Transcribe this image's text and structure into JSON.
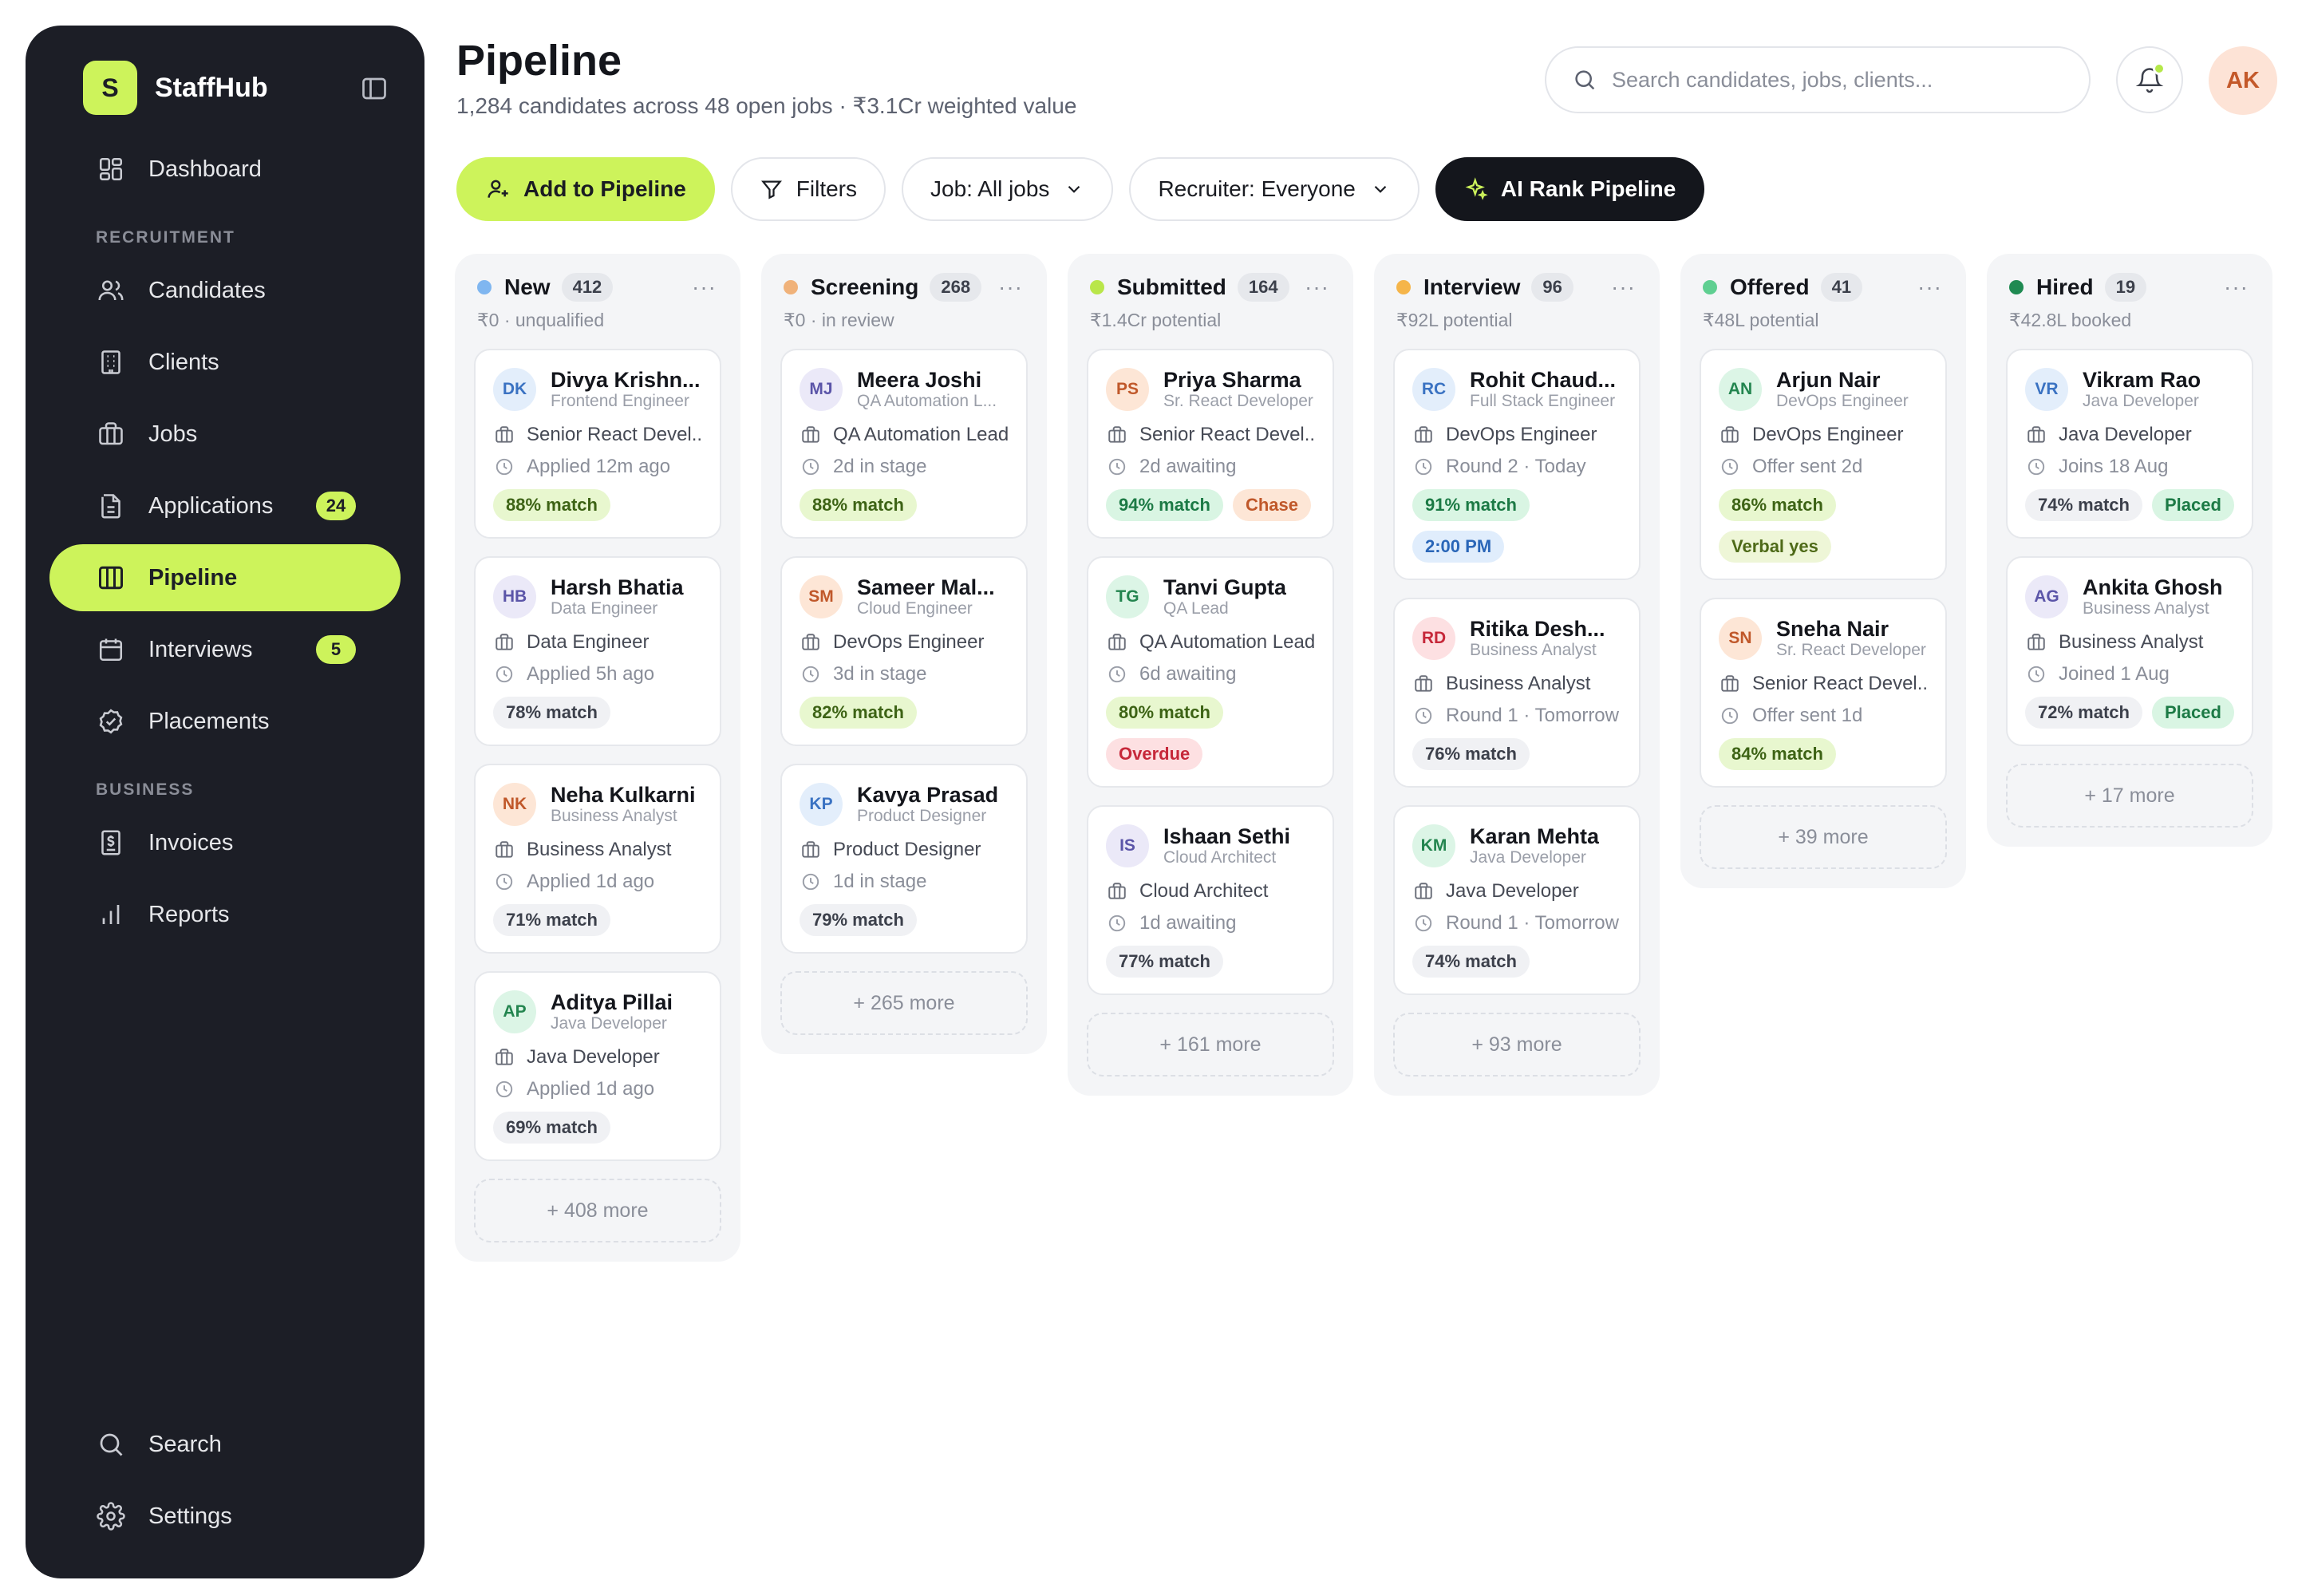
{
  "app": {
    "logo_letter": "S",
    "name": "StaffHub"
  },
  "sidebar": {
    "items": [
      {
        "label": "Dashboard",
        "icon": "dashboard-icon"
      },
      {
        "label": "Candidates",
        "icon": "users-icon"
      },
      {
        "label": "Clients",
        "icon": "building-icon"
      },
      {
        "label": "Jobs",
        "icon": "briefcase-icon"
      },
      {
        "label": "Applications",
        "icon": "document-icon",
        "badge": "24"
      },
      {
        "label": "Pipeline",
        "icon": "columns-icon",
        "active": true
      },
      {
        "label": "Interviews",
        "icon": "calendar-icon",
        "badge": "5"
      },
      {
        "label": "Placements",
        "icon": "check-badge-icon"
      },
      {
        "label": "Invoices",
        "icon": "invoice-icon"
      },
      {
        "label": "Reports",
        "icon": "bar-chart-icon"
      }
    ],
    "sections": {
      "recruitment": "RECRUITMENT",
      "business": "BUSINESS"
    },
    "bottom": [
      {
        "label": "Search",
        "icon": "search-icon"
      },
      {
        "label": "Settings",
        "icon": "gear-icon"
      }
    ]
  },
  "header": {
    "title": "Pipeline",
    "subtitle": "1,284 candidates across 48 open jobs · ₹3.1Cr weighted value",
    "search_placeholder": "Search candidates, jobs, clients...",
    "avatar_initials": "AK"
  },
  "toolbar": {
    "add": "Add to Pipeline",
    "filters": "Filters",
    "job": "Job: All jobs",
    "recruiter": "Recruiter: Everyone",
    "ai_rank": "AI Rank Pipeline"
  },
  "colors": {
    "accent": "#cdf35b",
    "sidebar_bg": "#1c1e26",
    "stage_new": "#7fb6f0",
    "stage_screening": "#f0b27a",
    "stage_submitted": "#b9e64a",
    "stage_interview": "#f5b54a",
    "stage_offered": "#5fcf91",
    "stage_hired": "#1f8a52"
  },
  "columns": [
    {
      "name": "New",
      "count": "412",
      "sub": "₹0 · unqualified",
      "dot": "#7fb6f0",
      "more": "+ 408 more",
      "cards": [
        {
          "initials": "DK",
          "av_bg": "#e3eefb",
          "av_fg": "#3a72c2",
          "name": "Divya Krishn...",
          "role": "Frontend Engineer",
          "job": "Senior React Devel...",
          "time": "Applied 12m ago",
          "chips": [
            {
              "text": "88% match",
              "cls": "match-high"
            }
          ]
        },
        {
          "initials": "HB",
          "av_bg": "#ebe9f8",
          "av_fg": "#5b55a8",
          "name": "Harsh Bhatia",
          "role": "Data Engineer",
          "job": "Data Engineer",
          "time": "Applied 5h ago",
          "chips": [
            {
              "text": "78% match",
              "cls": "match-low"
            }
          ]
        },
        {
          "initials": "NK",
          "av_bg": "#fde6d6",
          "av_fg": "#c0582a",
          "name": "Neha Kulkarni",
          "role": "Business Analyst",
          "job": "Business Analyst",
          "time": "Applied 1d ago",
          "chips": [
            {
              "text": "71% match",
              "cls": "match-low"
            }
          ]
        },
        {
          "initials": "AP",
          "av_bg": "#dcf5e6",
          "av_fg": "#23854f",
          "name": "Aditya Pillai",
          "role": "Java Developer",
          "job": "Java Developer",
          "time": "Applied 1d ago",
          "chips": [
            {
              "text": "69% match",
              "cls": "match-low"
            }
          ]
        }
      ]
    },
    {
      "name": "Screening",
      "count": "268",
      "sub": "₹0 · in review",
      "dot": "#f0b27a",
      "more": "+ 265 more",
      "cards": [
        {
          "initials": "MJ",
          "av_bg": "#ebe9f8",
          "av_fg": "#5b55a8",
          "name": "Meera Joshi",
          "role": "QA Automation L...",
          "job": "QA Automation Lead",
          "time": "2d in stage",
          "chips": [
            {
              "text": "88% match",
              "cls": "match-high"
            }
          ]
        },
        {
          "initials": "SM",
          "av_bg": "#fde6d6",
          "av_fg": "#c0582a",
          "name": "Sameer Mal...",
          "role": "Cloud Engineer",
          "job": "DevOps Engineer",
          "time": "3d in stage",
          "chips": [
            {
              "text": "82% match",
              "cls": "match-high"
            }
          ]
        },
        {
          "initials": "KP",
          "av_bg": "#e3eefb",
          "av_fg": "#3a72c2",
          "name": "Kavya Prasad",
          "role": "Product Designer",
          "job": "Product Designer",
          "time": "1d in stage",
          "chips": [
            {
              "text": "79% match",
              "cls": "match-low"
            }
          ]
        }
      ]
    },
    {
      "name": "Submitted",
      "count": "164",
      "sub": "₹1.4Cr potential",
      "dot": "#b9e64a",
      "more": "+ 161 more",
      "cards": [
        {
          "initials": "PS",
          "av_bg": "#fde6d6",
          "av_fg": "#c0582a",
          "name": "Priya Sharma",
          "role": "Sr. React Developer",
          "job": "Senior React Devel...",
          "time": "2d awaiting",
          "chips": [
            {
              "text": "94% match",
              "cls": "match-strong"
            },
            {
              "text": "Chase",
              "cls": "orange"
            }
          ]
        },
        {
          "initials": "TG",
          "av_bg": "#dcf5e6",
          "av_fg": "#23854f",
          "name": "Tanvi Gupta",
          "role": "QA Lead",
          "job": "QA Automation Lead",
          "time": "6d awaiting",
          "chips": [
            {
              "text": "80% match",
              "cls": "match-high"
            },
            {
              "text": "Overdue",
              "cls": "red"
            }
          ]
        },
        {
          "initials": "IS",
          "av_bg": "#ebe9f8",
          "av_fg": "#5b55a8",
          "name": "Ishaan Sethi",
          "role": "Cloud Architect",
          "job": "Cloud Architect",
          "time": "1d awaiting",
          "chips": [
            {
              "text": "77% match",
              "cls": "match-low"
            }
          ]
        }
      ]
    },
    {
      "name": "Interview",
      "count": "96",
      "sub": "₹92L potential",
      "dot": "#f5b54a",
      "more": "+ 93 more",
      "cards": [
        {
          "initials": "RC",
          "av_bg": "#e3eefb",
          "av_fg": "#3a72c2",
          "name": "Rohit Chaud...",
          "role": "Full Stack Engineer",
          "job": "DevOps Engineer",
          "time": "Round 2 · Today",
          "chips": [
            {
              "text": "91% match",
              "cls": "match-strong"
            },
            {
              "text": "2:00 PM",
              "cls": "blue"
            }
          ]
        },
        {
          "initials": "RD",
          "av_bg": "#fde0e2",
          "av_fg": "#c6283a",
          "name": "Ritika Desh...",
          "role": "Business Analyst",
          "job": "Business Analyst",
          "time": "Round 1 · Tomorrow",
          "chips": [
            {
              "text": "76% match",
              "cls": "match-low"
            }
          ]
        },
        {
          "initials": "KM",
          "av_bg": "#dcf5e6",
          "av_fg": "#23854f",
          "name": "Karan Mehta",
          "role": "Java Developer",
          "job": "Java Developer",
          "time": "Round 1 · Tomorrow",
          "chips": [
            {
              "text": "74% match",
              "cls": "match-low"
            }
          ]
        }
      ]
    },
    {
      "name": "Offered",
      "count": "41",
      "sub": "₹48L potential",
      "dot": "#5fcf91",
      "more": "+ 39 more",
      "cards": [
        {
          "initials": "AN",
          "av_bg": "#dcf5e6",
          "av_fg": "#23854f",
          "name": "Arjun Nair",
          "role": "DevOps Engineer",
          "job": "DevOps Engineer",
          "time": "Offer sent 2d",
          "chips": [
            {
              "text": "86% match",
              "cls": "match-high"
            },
            {
              "text": "Verbal yes",
              "cls": "olive"
            }
          ]
        },
        {
          "initials": "SN",
          "av_bg": "#fde6d6",
          "av_fg": "#c0582a",
          "name": "Sneha Nair",
          "role": "Sr. React Developer",
          "job": "Senior React Devel...",
          "time": "Offer sent 1d",
          "chips": [
            {
              "text": "84% match",
              "cls": "match-high"
            }
          ]
        }
      ]
    },
    {
      "name": "Hired",
      "count": "19",
      "sub": "₹42.8L booked",
      "dot": "#1f8a52",
      "more": "+ 17 more",
      "cards": [
        {
          "initials": "VR",
          "av_bg": "#e3eefb",
          "av_fg": "#3a72c2",
          "name": "Vikram Rao",
          "role": "Java Developer",
          "job": "Java Developer",
          "time": "Joins 18 Aug",
          "chips": [
            {
              "text": "74% match",
              "cls": "match-low"
            },
            {
              "text": "Placed",
              "cls": "green"
            }
          ]
        },
        {
          "initials": "AG",
          "av_bg": "#ebe9f8",
          "av_fg": "#5b55a8",
          "name": "Ankita Ghosh",
          "role": "Business Analyst",
          "job": "Business Analyst",
          "time": "Joined 1 Aug",
          "chips": [
            {
              "text": "72% match",
              "cls": "match-low"
            },
            {
              "text": "Placed",
              "cls": "green"
            }
          ]
        }
      ]
    }
  ]
}
